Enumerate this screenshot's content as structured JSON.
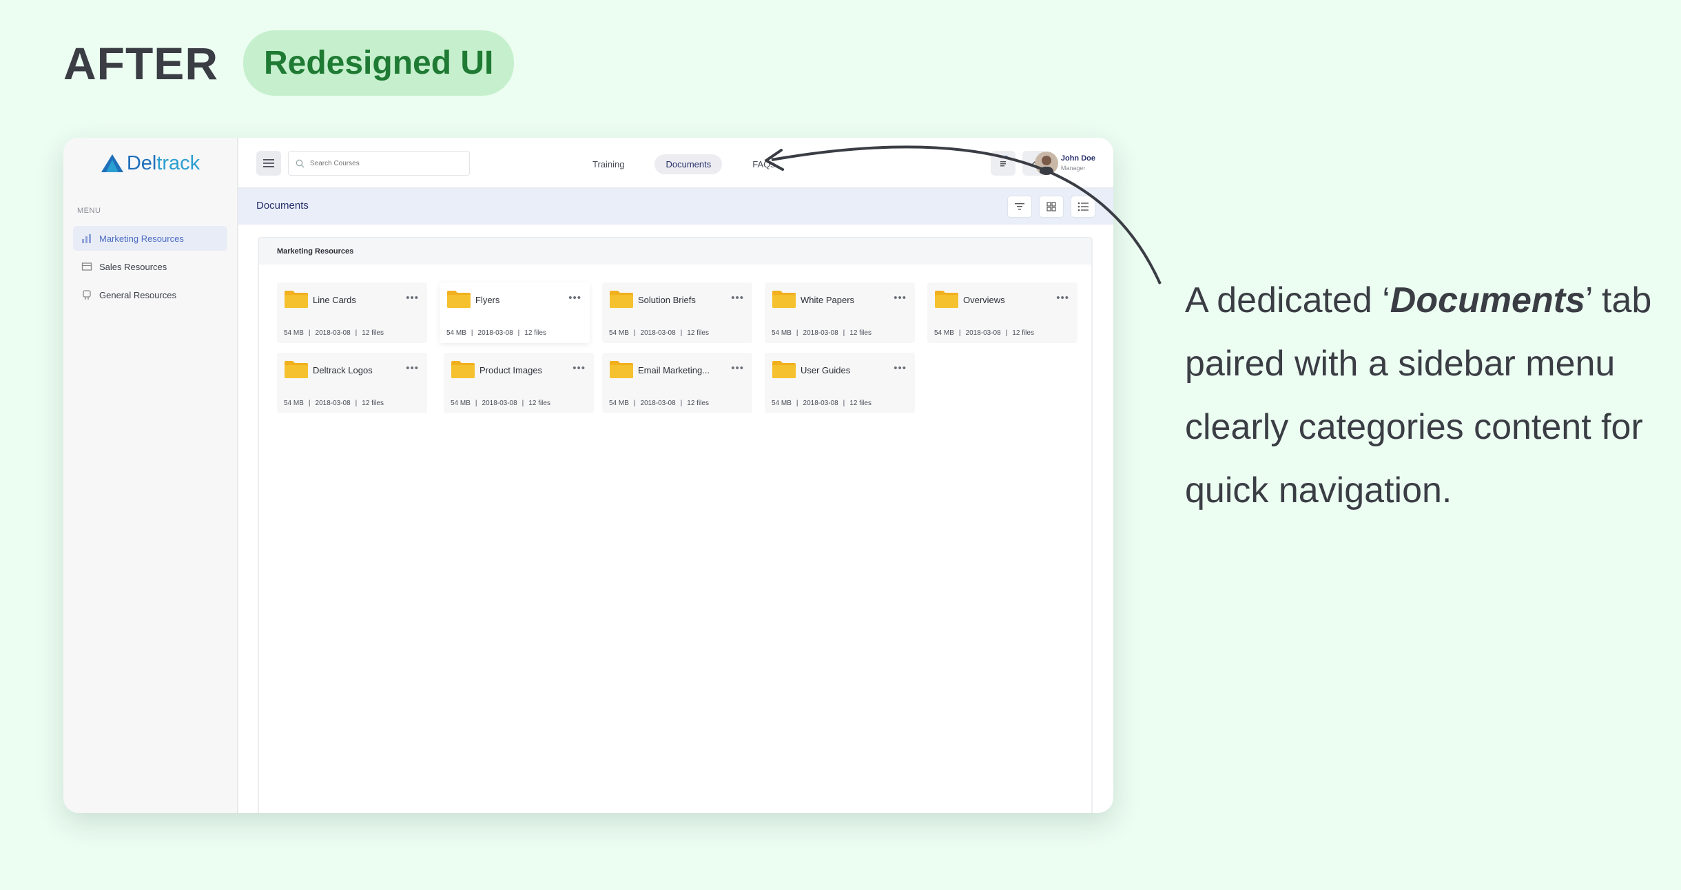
{
  "header": {
    "after_label": "AFTER",
    "pill_label": "Redesigned UI"
  },
  "app": {
    "logo_prefix": "Del",
    "logo_suffix": "track",
    "sidebar": {
      "menu_label": "MENU",
      "items": [
        {
          "label": "Marketing Resources",
          "icon": "chart-icon",
          "active": true
        },
        {
          "label": "Sales Resources",
          "icon": "box-icon",
          "active": false
        },
        {
          "label": "General Resources",
          "icon": "hand-icon",
          "active": false
        }
      ]
    },
    "topbar": {
      "search_placeholder": "Search Courses",
      "tabs": [
        {
          "label": "Training",
          "active": false
        },
        {
          "label": "Documents",
          "active": true
        },
        {
          "label": "FAQs",
          "active": false
        }
      ],
      "user_name": "John Doe",
      "user_role": "Manager"
    },
    "subbar_title": "Documents",
    "panel_title": "Marketing Resources",
    "folders": [
      {
        "name": "Line Cards",
        "size": "54 MB",
        "date": "2018-03-08",
        "files": "12 files"
      },
      {
        "name": "Flyers",
        "size": "54 MB",
        "date": "2018-03-08",
        "files": "12 files"
      },
      {
        "name": "Solution Briefs",
        "size": "54 MB",
        "date": "2018-03-08",
        "files": "12 files"
      },
      {
        "name": "White Papers",
        "size": "54 MB",
        "date": "2018-03-08",
        "files": "12 files"
      },
      {
        "name": "Overviews",
        "size": "54 MB",
        "date": "2018-03-08",
        "files": "12 files"
      },
      {
        "name": "Deltrack Logos",
        "size": "54 MB",
        "date": "2018-03-08",
        "files": "12 files"
      },
      {
        "name": "Product Images",
        "size": "54 MB",
        "date": "2018-03-08",
        "files": "12 files"
      },
      {
        "name": "Email Marketing...",
        "size": "54 MB",
        "date": "2018-03-08",
        "files": "12 files"
      },
      {
        "name": "User Guides",
        "size": "54 MB",
        "date": "2018-03-08",
        "files": "12 files"
      }
    ]
  },
  "annotation": {
    "line1_pre": "A dedicated ‘",
    "line1_em": "Documents",
    "line1_post": "’",
    "rest": "tab paired with a sidebar menu clearly categories content for quick navigation."
  },
  "colors": {
    "background": "#ecfdf2",
    "pill": "#c6f0cd",
    "accent": "#4b6cc2",
    "folder": "#f5c12e"
  }
}
